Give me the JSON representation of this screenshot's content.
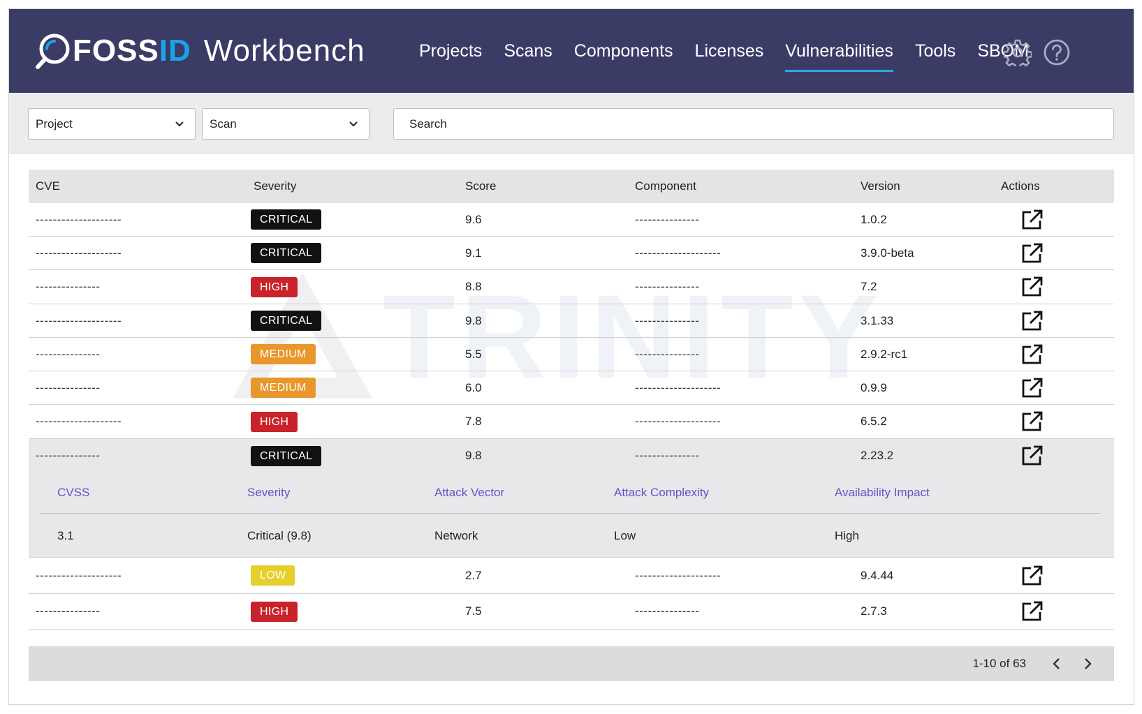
{
  "header": {
    "logo_text_a": "FOSS",
    "logo_text_b": "ID",
    "logo_sub": "Workbench",
    "nav": [
      {
        "label": "Projects",
        "active": false
      },
      {
        "label": "Scans",
        "active": false
      },
      {
        "label": "Components",
        "active": false
      },
      {
        "label": "Licenses",
        "active": false
      },
      {
        "label": "Vulnerabilities",
        "active": true
      },
      {
        "label": "Tools",
        "active": false
      },
      {
        "label": "SBOM",
        "active": false
      }
    ],
    "icons": [
      "gear-icon",
      "help-icon"
    ]
  },
  "filters": {
    "project_select": "Project",
    "scan_select": "Scan",
    "search_placeholder": "Search"
  },
  "table": {
    "columns": [
      "CVE",
      "Severity",
      "Score",
      "Component",
      "Version",
      "Actions"
    ],
    "rows": [
      {
        "cve": "--------------------",
        "severity": "CRITICAL",
        "score": "9.6",
        "component": "---------------",
        "version": "1.0.2"
      },
      {
        "cve": "--------------------",
        "severity": "CRITICAL",
        "score": "9.1",
        "component": "--------------------",
        "version": "3.9.0-beta"
      },
      {
        "cve": "---------------",
        "severity": "HIGH",
        "score": "8.8",
        "component": "---------------",
        "version": "7.2"
      },
      {
        "cve": "--------------------",
        "severity": "CRITICAL",
        "score": "9.8",
        "component": "---------------",
        "version": "3.1.33"
      },
      {
        "cve": "---------------",
        "severity": "MEDIUM",
        "score": "5.5",
        "component": "---------------",
        "version": "2.9.2-rc1"
      },
      {
        "cve": "---------------",
        "severity": "MEDIUM",
        "score": "6.0",
        "component": "--------------------",
        "version": "0.9.9"
      },
      {
        "cve": "--------------------",
        "severity": "HIGH",
        "score": "7.8",
        "component": "--------------------",
        "version": "6.5.2"
      },
      {
        "cve": "---------------",
        "severity": "CRITICAL",
        "score": "9.8",
        "component": "---------------",
        "version": "2.23.2",
        "expanded": true
      },
      {
        "cve": "--------------------",
        "severity": "LOW",
        "score": "2.7",
        "component": "--------------------",
        "version": "9.4.44"
      },
      {
        "cve": "---------------",
        "severity": "HIGH",
        "score": "7.5",
        "component": "---------------",
        "version": "2.7.3"
      }
    ],
    "detail": {
      "headers": [
        "CVSS",
        "Severity",
        "Attack Vector",
        "Attack Complexity",
        "Availability Impact"
      ],
      "values": [
        "3.1",
        "Critical (9.8)",
        "Network",
        "Low",
        "High"
      ]
    }
  },
  "severity_colors": {
    "CRITICAL": {
      "bg": "#111111",
      "fg": "#ffffff"
    },
    "HIGH": {
      "bg": "#c8232a",
      "fg": "#ffffff"
    },
    "MEDIUM": {
      "bg": "#e9962b",
      "fg": "#ffffff"
    },
    "LOW": {
      "bg": "#e6cf2a",
      "fg": "#ffffff"
    }
  },
  "pagination": {
    "range": "1-10 of 63"
  },
  "colors": {
    "header_bg": "#3b3c66",
    "accent": "#2ea7e6",
    "detail_label": "#6a4fc9"
  },
  "watermark_text": "TRINITY"
}
